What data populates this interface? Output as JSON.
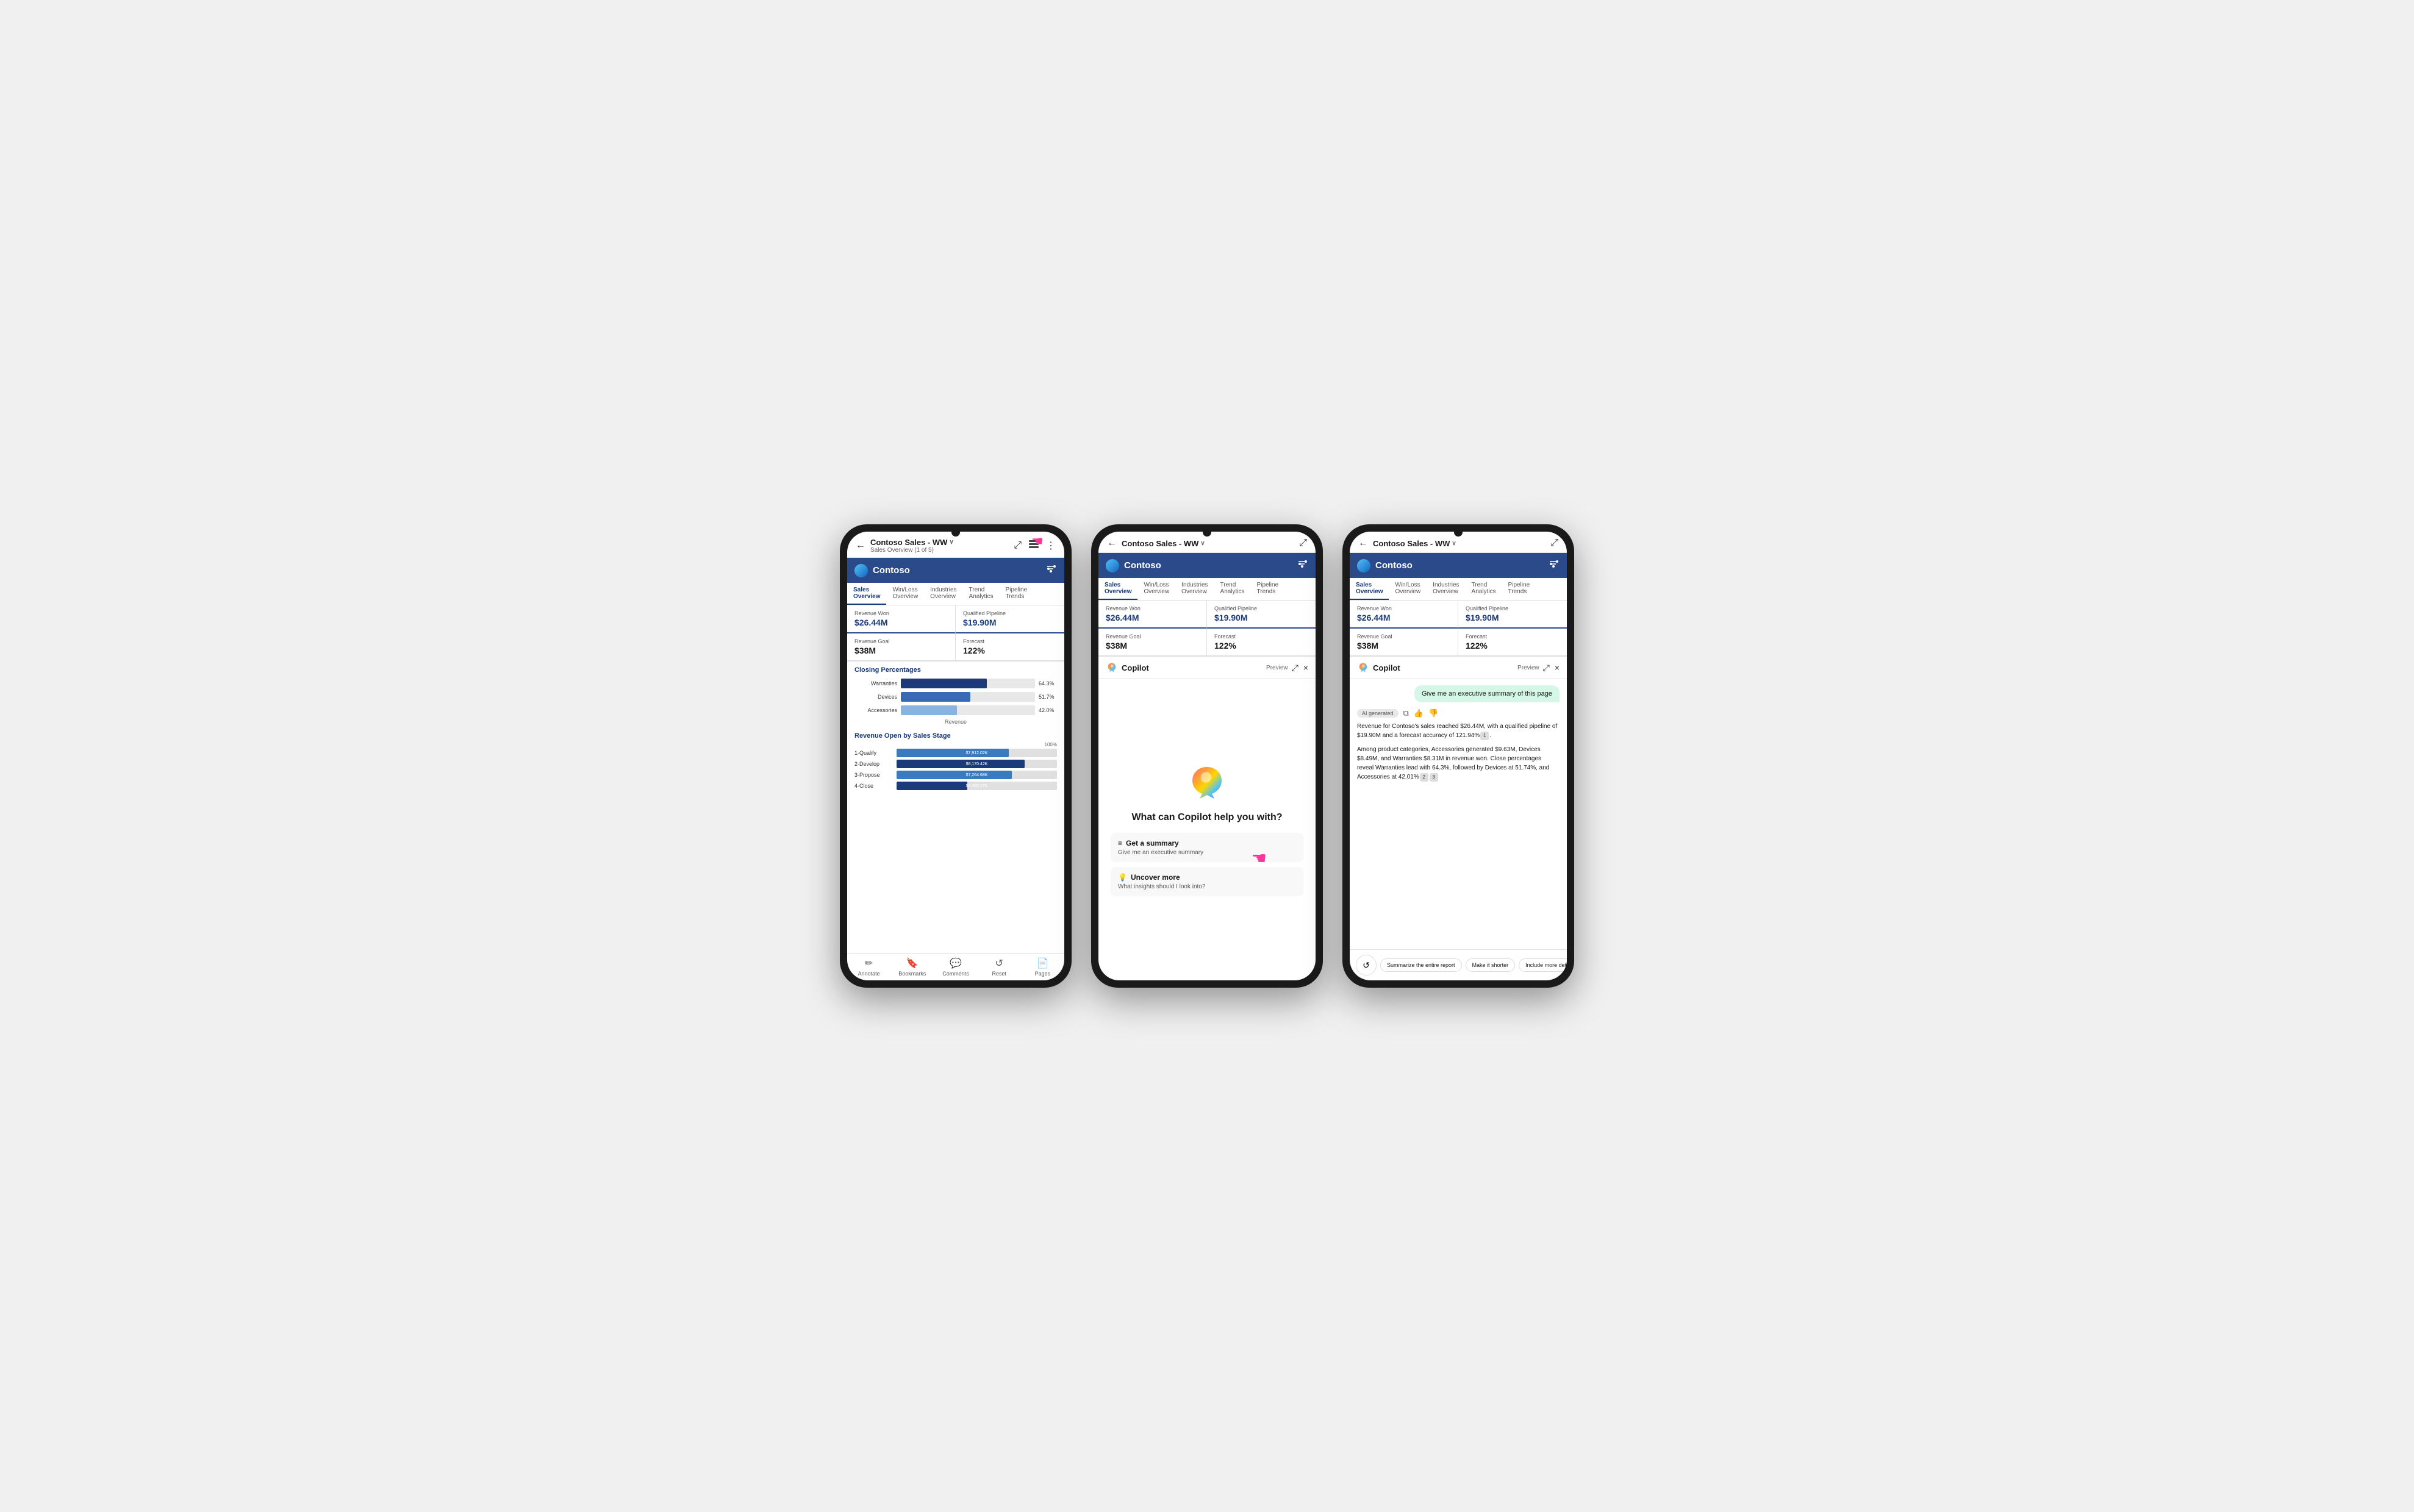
{
  "phone1": {
    "topbar": {
      "back_icon": "←",
      "title": "Contoso Sales - WW",
      "chevron": "∨",
      "subtitle": "Sales Overview (1 of 5)",
      "expand_icon": "⤢",
      "layers_icon": "⧉",
      "more_icon": "⋮"
    },
    "contoso": {
      "name": "Contoso",
      "filter_icon": "⊞"
    },
    "tabs": [
      {
        "label": "Sales Overview",
        "active": true
      },
      {
        "label": "Win/Loss Overview",
        "active": false
      },
      {
        "label": "Industries Overview",
        "active": false
      },
      {
        "label": "Trend Analytics",
        "active": false
      },
      {
        "label": "Pipeline Trends",
        "active": false
      }
    ],
    "stats": [
      {
        "label": "Revenue Won",
        "value": "$26.44M"
      },
      {
        "label": "Qualified Pipeline",
        "value": "$19.90M"
      },
      {
        "label": "Revenue Goal",
        "value": "$38M"
      },
      {
        "label": "Forecast",
        "value": "122%"
      }
    ],
    "closing_section": "Closing Percentages",
    "bars": [
      {
        "label": "Warranties",
        "pct": 64.3,
        "pct_label": "64.3%",
        "shade": "dark"
      },
      {
        "label": "Devices",
        "pct": 51.7,
        "pct_label": "51.7%",
        "shade": "medium"
      },
      {
        "label": "Accessories",
        "pct": 42.0,
        "pct_label": "42.0%",
        "shade": "light"
      }
    ],
    "bar_xlabel": "Revenue",
    "revenue_section": "Revenue Open by Sales Stage",
    "pct_label": "100%",
    "stages": [
      {
        "label": "1-Qualify",
        "value": "$7,912.02K",
        "width": 70,
        "shade": "medium"
      },
      {
        "label": "2-Develop",
        "value": "$8,170.42K",
        "width": 80,
        "shade": "dark"
      },
      {
        "label": "3-Propose",
        "value": "$7,264.68K",
        "width": 72,
        "shade": "medium"
      },
      {
        "label": "4-Close",
        "value": "$4,465.27K",
        "width": 45,
        "shade": "dark"
      }
    ],
    "bottom_nav": [
      {
        "icon": "✏",
        "label": "Annotate"
      },
      {
        "icon": "🔖",
        "label": "Bookmarks"
      },
      {
        "icon": "💬",
        "label": "Comments"
      },
      {
        "icon": "↺",
        "label": "Reset"
      },
      {
        "icon": "📄",
        "label": "Pages"
      }
    ]
  },
  "phone2": {
    "topbar": {
      "back_icon": "←",
      "title": "Contoso Sales - WW",
      "chevron": "∨",
      "expand_icon": "⤢"
    },
    "contoso": {
      "name": "Contoso",
      "filter_icon": "⊞"
    },
    "tabs": [
      {
        "label": "Sales Overview",
        "active": true
      },
      {
        "label": "Win/Loss Overview",
        "active": false
      },
      {
        "label": "Industries Overview",
        "active": false
      },
      {
        "label": "Trend Analytics",
        "active": false
      },
      {
        "label": "Pipeline Trends",
        "active": false
      }
    ],
    "stats": [
      {
        "label": "Revenue Won",
        "value": "$26.44M"
      },
      {
        "label": "Qualified Pipeline",
        "value": "$19.90M"
      },
      {
        "label": "Revenue Goal",
        "value": "$38M"
      },
      {
        "label": "Forecast",
        "value": "122%"
      }
    ],
    "copilot": {
      "title": "Copilot",
      "preview": "Preview",
      "expand_icon": "⤢",
      "close_icon": "×",
      "question": "What can Copilot help you with?",
      "suggestions": [
        {
          "icon": "≡",
          "title": "Get a summary",
          "desc": "Give me an executive summary"
        },
        {
          "icon": "💡",
          "title": "Uncover more",
          "desc": "What insights should I look into?"
        }
      ]
    }
  },
  "phone3": {
    "topbar": {
      "back_icon": "←",
      "title": "Contoso Sales - WW",
      "chevron": "∨",
      "expand_icon": "⤢"
    },
    "contoso": {
      "name": "Contoso",
      "filter_icon": "⊞"
    },
    "tabs": [
      {
        "label": "Sales Overview",
        "active": true
      },
      {
        "label": "Win/Loss Overview",
        "active": false
      },
      {
        "label": "Industries Overview",
        "active": false
      },
      {
        "label": "Trend Analytics",
        "active": false
      },
      {
        "label": "Pipeline Trends",
        "active": false
      }
    ],
    "stats": [
      {
        "label": "Revenue Won",
        "value": "$26.44M"
      },
      {
        "label": "Qualified Pipeline",
        "value": "$19.90M"
      },
      {
        "label": "Revenue Goal",
        "value": "$38M"
      },
      {
        "label": "Forecast",
        "value": "122%"
      }
    ],
    "copilot": {
      "title": "Copilot",
      "preview": "Preview",
      "expand_icon": "⤢",
      "close_icon": "×",
      "user_message": "Give me an executive summary of this page",
      "ai_generated_badge": "AI generated",
      "ai_response_p1": "Revenue for Contoso's sales reached $26.44M, with a qualified pipeline of $19.90M and a forecast accuracy of 121.94%",
      "ai_response_p2": "Among product categories, Accessories generated $9.63M, Devices $8.49M, and Warranties $8.31M in revenue won. Close percentages reveal Warranties lead with 64.3%, followed by Devices at 51.74%, and Accessories at 42.01%",
      "footnote1": "1",
      "footnote2": "2",
      "footnote3": "3",
      "actions": {
        "refresh_icon": "↺",
        "btn1": "Summarize the entire report",
        "btn2": "Make it shorter",
        "btn3": "Include more details"
      }
    }
  }
}
